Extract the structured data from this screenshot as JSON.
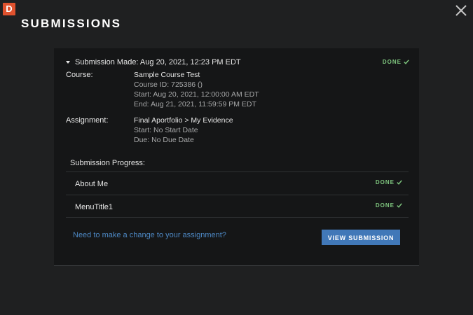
{
  "app": {
    "logo_letter": "D",
    "page_title": "SUBMISSIONS",
    "brand_color": "#e0522e",
    "accent_color": "#4178b8",
    "done_color": "#7fc77f"
  },
  "submission": {
    "summary": "Submission Made: Aug 20, 2021, 12:23 PM EDT",
    "status": "DONE",
    "course": {
      "label": "Course:",
      "name": "Sample Course Test",
      "course_id": "Course ID: 725386 ()",
      "start": "Start: Aug 20, 2021, 12:00:00 AM EDT",
      "end": "End: Aug 21, 2021, 11:59:59 PM EDT"
    },
    "assignment": {
      "label": "Assignment:",
      "name": "Final Aportfolio > My Evidence",
      "start": "Start: No Start Date",
      "due": "Due: No Due Date"
    },
    "progress": {
      "label": "Submission Progress:",
      "items": [
        {
          "label": "About Me",
          "status": "DONE"
        },
        {
          "label": "MenuTitle1",
          "status": "DONE"
        }
      ]
    },
    "change_link": "Need to make a change to your assignment?",
    "view_button": "VIEW SUBMISSION"
  },
  "icons": {
    "close": "close-icon",
    "caret": "caret-down-icon",
    "check": "check-icon"
  }
}
